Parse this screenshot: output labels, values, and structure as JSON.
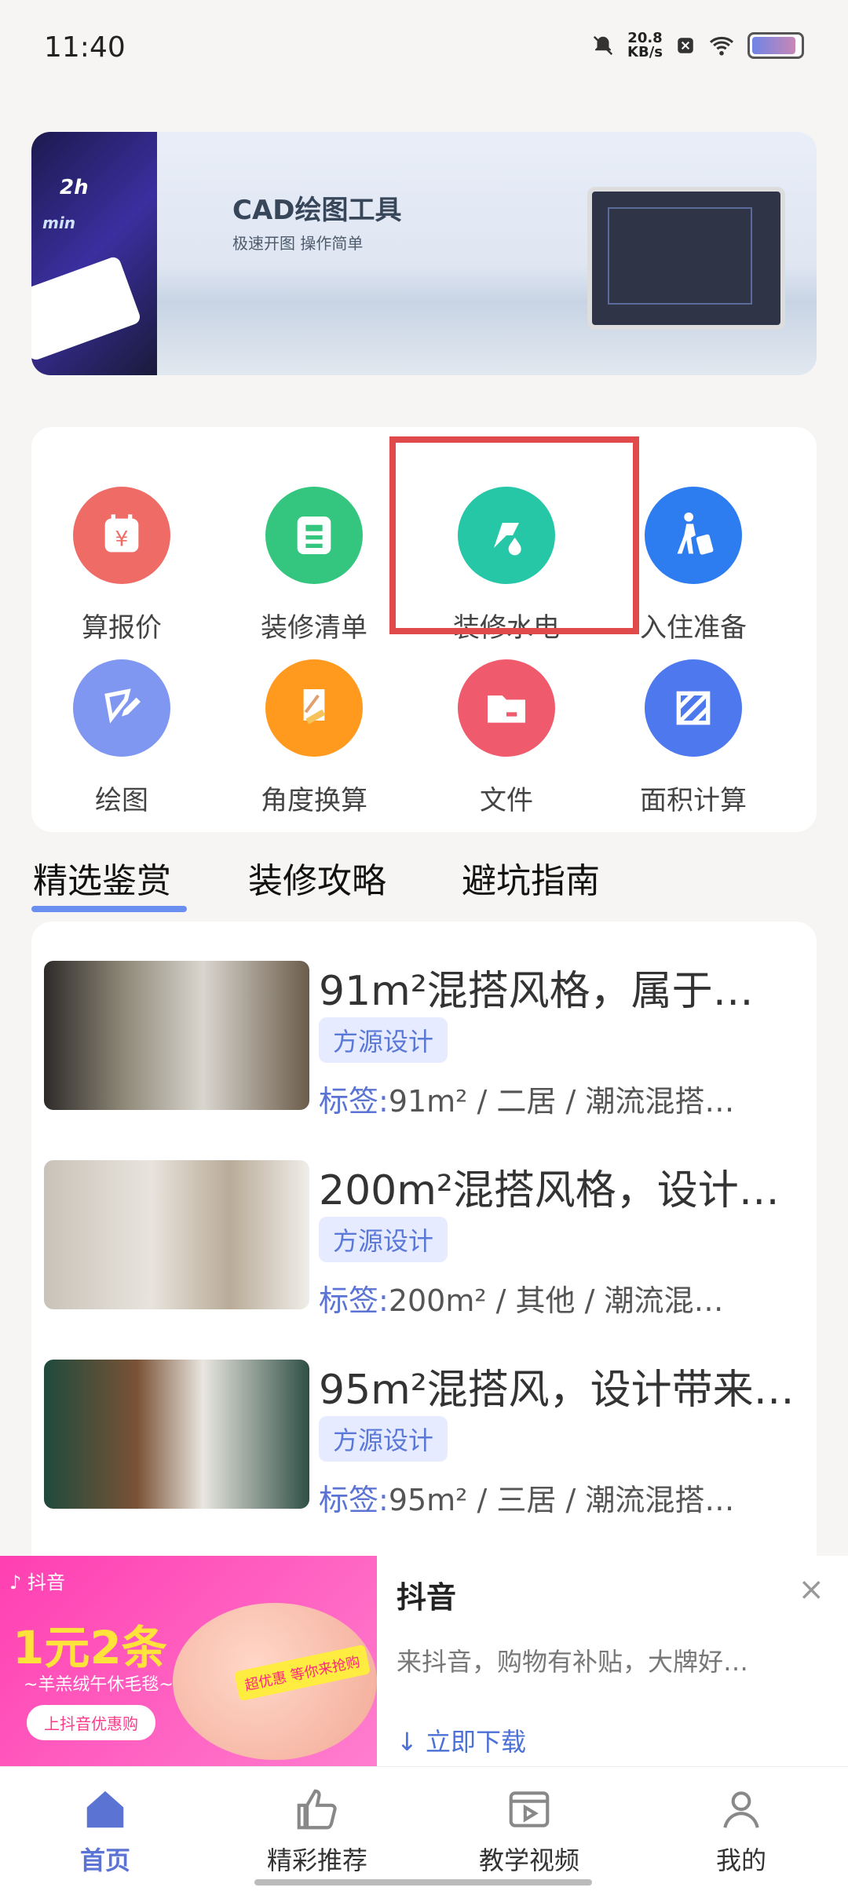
{
  "status": {
    "time": "11:40",
    "rate_top": "20.8",
    "rate_bottom": "KB/s"
  },
  "banner": {
    "title": "CAD绘图工具",
    "subtitle": "极速开图 操作简单",
    "badge1": "2h",
    "badge2": "min"
  },
  "tools": [
    {
      "label": "算报价",
      "icon": "calculator-yen-icon",
      "color": "#ef6b66"
    },
    {
      "label": "装修清单",
      "icon": "list-document-icon",
      "color": "#34c67f"
    },
    {
      "label": "装修水电",
      "icon": "water-electric-icon",
      "color": "#25c7a7"
    },
    {
      "label": "入住准备",
      "icon": "move-in-luggage-icon",
      "color": "#2e7df0"
    },
    {
      "label": "绘图",
      "icon": "drawing-pen-icon",
      "color": "#7f97f1"
    },
    {
      "label": "角度换算",
      "icon": "angle-ruler-icon",
      "color": "#ff9a1e"
    },
    {
      "label": "文件",
      "icon": "folder-icon",
      "color": "#ef5b6d"
    },
    {
      "label": "面积计算",
      "icon": "area-frame-icon",
      "color": "#4e78ee"
    }
  ],
  "tabs": [
    "精选鉴赏",
    "装修攻略",
    "避坑指南"
  ],
  "articles": [
    {
      "title": "91m²混搭风格，属于…",
      "tag": "方源设计",
      "tags_key": "标签:",
      "tags_value": "91m² / 二居 / 潮流混搭…"
    },
    {
      "title": "200m²混搭风格，设计…",
      "tag": "方源设计",
      "tags_key": "标签:",
      "tags_value": "200m² / 其他 / 潮流混…"
    },
    {
      "title": "95m²混搭风，设计带来…",
      "tag": "方源设计",
      "tags_key": "标签:",
      "tags_value": "95m² / 三居 / 潮流混搭…"
    }
  ],
  "ad": {
    "brand": "抖音",
    "name": "抖音",
    "headline": "1元2条",
    "line": "~羊羔绒午休毛毯~",
    "pill": "上抖音优惠购",
    "stamp": "超优惠 等你来抢购",
    "desc": "来抖音，购物有补贴，大牌好…",
    "cta": "↓ 立即下载",
    "close": "×"
  },
  "nav": [
    {
      "label": "首页",
      "icon": "home-icon",
      "active": true
    },
    {
      "label": "精彩推荐",
      "icon": "thumbs-up-icon",
      "active": false
    },
    {
      "label": "教学视频",
      "icon": "video-icon",
      "active": false
    },
    {
      "label": "我的",
      "icon": "profile-icon",
      "active": false
    }
  ]
}
